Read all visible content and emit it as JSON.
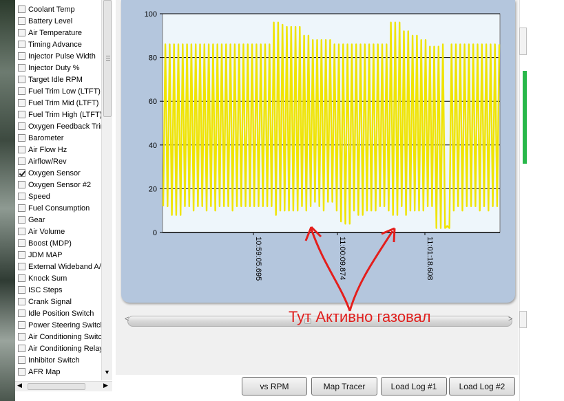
{
  "params": {
    "items": [
      {
        "label": "Coolant Temp",
        "checked": false
      },
      {
        "label": "Battery Level",
        "checked": false
      },
      {
        "label": "Air Temperature",
        "checked": false
      },
      {
        "label": "Timing Advance",
        "checked": false
      },
      {
        "label": "Injector Pulse Width",
        "checked": false
      },
      {
        "label": "Injector Duty %",
        "checked": false
      },
      {
        "label": "Target Idle RPM",
        "checked": false
      },
      {
        "label": "Fuel Trim Low (LTFT)",
        "checked": false
      },
      {
        "label": "Fuel Trim Mid (LTFT)",
        "checked": false
      },
      {
        "label": "Fuel Trim High (LTFT)",
        "checked": false
      },
      {
        "label": "Oxygen Feedback Trim",
        "checked": false
      },
      {
        "label": "Barometer",
        "checked": false
      },
      {
        "label": "Air Flow Hz",
        "checked": false
      },
      {
        "label": "Airflow/Rev",
        "checked": false
      },
      {
        "label": "Oxygen Sensor",
        "checked": true
      },
      {
        "label": "Oxygen Sensor #2",
        "checked": false
      },
      {
        "label": "Speed",
        "checked": false
      },
      {
        "label": "Fuel Consumption",
        "checked": false
      },
      {
        "label": "Gear",
        "checked": false
      },
      {
        "label": "Air Volume",
        "checked": false
      },
      {
        "label": "Boost (MDP)",
        "checked": false
      },
      {
        "label": "JDM MAP",
        "checked": false
      },
      {
        "label": "External Wideband A/F",
        "checked": false
      },
      {
        "label": "Knock Sum",
        "checked": false
      },
      {
        "label": "ISC Steps",
        "checked": false
      },
      {
        "label": "Crank Signal",
        "checked": false
      },
      {
        "label": "Idle Position Switch",
        "checked": false
      },
      {
        "label": "Power Steering Switch",
        "checked": false
      },
      {
        "label": "Air Conditioning Switch",
        "checked": false
      },
      {
        "label": "Air Conditioning Relay",
        "checked": false
      },
      {
        "label": "Inhibitor Switch",
        "checked": false
      },
      {
        "label": "AFR Map",
        "checked": false
      }
    ],
    "scroll_down_icon": "down-arrow-icon",
    "scroll_left_icon": "left-arrow-icon",
    "scroll_right_icon": "right-arrow-icon"
  },
  "chart_data": {
    "type": "line",
    "series": [
      {
        "color": "#f0e400",
        "values": [
          12,
          86,
          12,
          86,
          8,
          86,
          8,
          86,
          8,
          86,
          12,
          86,
          12,
          86,
          10,
          86,
          12,
          86,
          12,
          86,
          10,
          86,
          12,
          86,
          10,
          86,
          12,
          86,
          12,
          86,
          12,
          86,
          10,
          86,
          12,
          86,
          12,
          86,
          12,
          86,
          12,
          86,
          12,
          86,
          12,
          86,
          12,
          86,
          12,
          86,
          12,
          96,
          8,
          96,
          10,
          95,
          10,
          94,
          10,
          94,
          10,
          94,
          10,
          94,
          12,
          90,
          10,
          90,
          12,
          88,
          14,
          88,
          12,
          88,
          10,
          88,
          14,
          88,
          14,
          86,
          10,
          86,
          5,
          86,
          4,
          86,
          4,
          86,
          10,
          86,
          8,
          86,
          8,
          86,
          10,
          86,
          10,
          86,
          10,
          86,
          12,
          86,
          12,
          86,
          10,
          96,
          8,
          96,
          8,
          96,
          12,
          92,
          8,
          92,
          10,
          90,
          10,
          90,
          10,
          88,
          10,
          88,
          12,
          85,
          12,
          85,
          2,
          85,
          2,
          86,
          2,
          3,
          2,
          86,
          10,
          86,
          12,
          86,
          10,
          86,
          12,
          86,
          12,
          86,
          12,
          86,
          10,
          86,
          12,
          86,
          10,
          86,
          12,
          86,
          12,
          86
        ]
      }
    ],
    "xticks": [
      "10:59:05.695",
      "11:00:09.874",
      "11:01:18.608"
    ],
    "yticks": [
      "0",
      "20",
      "40",
      "60",
      "80",
      "100"
    ],
    "ylim": [
      0,
      100
    ],
    "grid": true,
    "legend": "none"
  },
  "slider": {
    "left_icon": "left-chevron-icon",
    "right_icon": "right-chevron-icon",
    "value": 0.47
  },
  "annotation": {
    "text": "Тут Активно газовал"
  },
  "buttons": {
    "vs_rpm": "vs RPM",
    "map_tracer": "Map Tracer",
    "load_log_1": "Load Log #1",
    "load_log_2": "Load Log #2"
  }
}
